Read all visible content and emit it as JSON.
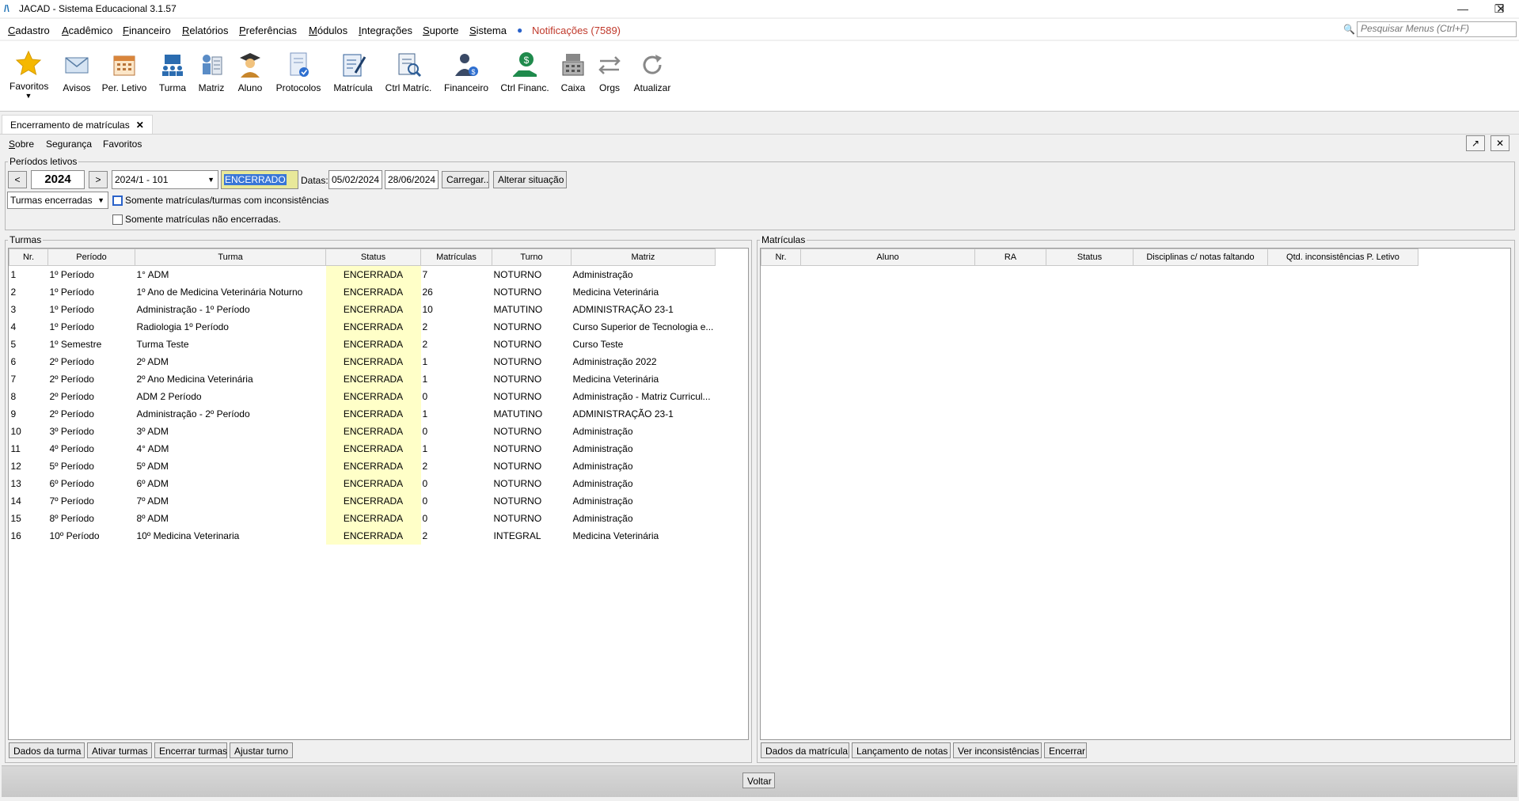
{
  "window": {
    "title": "JACAD - Sistema Educacional 3.1.57",
    "logo_glyph": "/\\",
    "controls": [
      "—",
      "❐",
      "✕"
    ]
  },
  "menubar": {
    "items": [
      {
        "label": "Cadastro",
        "ul": "C",
        "rest": "adastro"
      },
      {
        "label": "Acadêmico",
        "ul": "A",
        "rest": "cadêmico"
      },
      {
        "label": "Financeiro",
        "ul": "F",
        "rest": "inanceiro"
      },
      {
        "label": "Relatórios",
        "ul": "R",
        "rest": "elatórios"
      },
      {
        "label": "Preferências",
        "ul": "P",
        "rest": "referências"
      },
      {
        "label": "Módulos",
        "ul": "M",
        "rest": "ódulos"
      },
      {
        "label": "Integrações",
        "ul": "I",
        "rest": "ntegrações"
      },
      {
        "label": "Suporte",
        "ul": "S",
        "rest": "uporte"
      },
      {
        "label": "Sistema",
        "ul": "S",
        "rest": "istema"
      }
    ],
    "notifications": "Notificações (7589)",
    "search_placeholder": "Pesquisar Menus (Ctrl+F)"
  },
  "toolbar": {
    "items": [
      {
        "label": "Favoritos",
        "icon": "star-icon"
      },
      {
        "label": "Avisos",
        "icon": "envelope-icon"
      },
      {
        "label": "Per. Letivo",
        "icon": "calendar-icon"
      },
      {
        "label": "Turma",
        "icon": "class-icon"
      },
      {
        "label": "Matriz",
        "icon": "matrix-icon"
      },
      {
        "label": "Aluno",
        "icon": "student-icon"
      },
      {
        "label": "Protocolos",
        "icon": "protocol-icon"
      },
      {
        "label": "Matrícula",
        "icon": "enrollment-icon"
      },
      {
        "label": "Ctrl Matríc.",
        "icon": "enrollment-control-icon"
      },
      {
        "label": "Financeiro",
        "icon": "finance-icon"
      },
      {
        "label": "Ctrl Financ.",
        "icon": "finance-control-icon"
      },
      {
        "label": "Caixa",
        "icon": "cash-register-icon"
      },
      {
        "label": "Orgs",
        "icon": "swap-icon"
      },
      {
        "label": "Atualizar",
        "icon": "refresh-icon"
      }
    ]
  },
  "tab": {
    "label": "Encerramento de matrículas",
    "close": "✕"
  },
  "submenu": {
    "items": [
      {
        "ul": "S",
        "rest": "obre"
      },
      {
        "ul": "",
        "rest": "Segurança"
      },
      {
        "ul": "",
        "rest": "Favoritos"
      }
    ]
  },
  "periodos": {
    "title": "Períodos letivos",
    "prev": "<",
    "next": ">",
    "year": "2024",
    "periodo_select": "2024/1 - 101",
    "situacao": "ENCERRADO",
    "datas_label": "Datas:",
    "data_inicio": "05/02/2024",
    "data_fim": "28/06/2024",
    "carregar": "Carregar..",
    "alterar": "Alterar situação",
    "filtro_select": "Turmas encerradas",
    "chk1": "Somente matrículas/turmas com inconsistências",
    "chk2": "Somente matrículas não encerradas."
  },
  "turmas": {
    "title": "Turmas",
    "columns": [
      "Nr.",
      "Período",
      "Turma",
      "Status",
      "Matrículas",
      "Turno",
      "Matriz"
    ],
    "rows": [
      [
        "1",
        "1º Período",
        "1° ADM",
        "ENCERRADA",
        "7",
        "NOTURNO",
        "Administração"
      ],
      [
        "2",
        "1º Período",
        "1º Ano de Medicina Veterinária Noturno",
        "ENCERRADA",
        "26",
        "NOTURNO",
        "Medicina Veterinária"
      ],
      [
        "3",
        "1º Período",
        "Administração - 1º Período",
        "ENCERRADA",
        "10",
        "MATUTINO",
        "ADMINISTRAÇÃO 23-1"
      ],
      [
        "4",
        "1º Período",
        "Radiologia 1º Período",
        "ENCERRADA",
        "2",
        "NOTURNO",
        "Curso Superior de Tecnologia e..."
      ],
      [
        "5",
        "1º Semestre",
        "Turma Teste",
        "ENCERRADA",
        "2",
        "NOTURNO",
        "Curso Teste"
      ],
      [
        "6",
        "2º Período",
        "2º ADM",
        "ENCERRADA",
        "1",
        "NOTURNO",
        "Administração 2022"
      ],
      [
        "7",
        "2º Período",
        "2º Ano Medicina Veterinária",
        "ENCERRADA",
        "1",
        "NOTURNO",
        "Medicina Veterinária"
      ],
      [
        "8",
        "2º Período",
        "ADM 2 Período",
        "ENCERRADA",
        "0",
        "NOTURNO",
        "Administração - Matriz Curricul..."
      ],
      [
        "9",
        "2º Período",
        "Administração - 2º Período",
        "ENCERRADA",
        "1",
        "MATUTINO",
        "ADMINISTRAÇÃO 23-1"
      ],
      [
        "10",
        "3º Período",
        "3º ADM",
        "ENCERRADA",
        "0",
        "NOTURNO",
        "Administração"
      ],
      [
        "11",
        "4º Período",
        "4° ADM",
        "ENCERRADA",
        "1",
        "NOTURNO",
        "Administração"
      ],
      [
        "12",
        "5º Período",
        "5º ADM",
        "ENCERRADA",
        "2",
        "NOTURNO",
        "Administração"
      ],
      [
        "13",
        "6º Período",
        "6º ADM",
        "ENCERRADA",
        "0",
        "NOTURNO",
        "Administração"
      ],
      [
        "14",
        "7º Período",
        "7º ADM",
        "ENCERRADA",
        "0",
        "NOTURNO",
        "Administração"
      ],
      [
        "15",
        "8º Período",
        "8º ADM",
        "ENCERRADA",
        "0",
        "NOTURNO",
        "Administração"
      ],
      [
        "16",
        "10º Período",
        "10º  Medicina Veterinaria",
        "ENCERRADA",
        "2",
        "INTEGRAL",
        "Medicina Veterinária"
      ]
    ],
    "buttons": [
      "Dados da turma",
      "Ativar turmas",
      "Encerrar turmas",
      "Ajustar turno"
    ]
  },
  "matriculas": {
    "title": "Matrículas",
    "columns": [
      "Nr.",
      "Aluno",
      "RA",
      "Status",
      "Disciplinas c/ notas faltando",
      "Qtd. inconsistências P. Letivo"
    ],
    "buttons": [
      "Dados da matrícula",
      "Lançamento de notas",
      "Ver inconsistências",
      "Encerrar"
    ]
  },
  "footer": {
    "voltar": "Voltar"
  },
  "colors": {
    "status_bg": "#ffffc8",
    "situacao_bg": "#e8e89a",
    "selection": "#3875d7",
    "notif": "#c0392b"
  }
}
